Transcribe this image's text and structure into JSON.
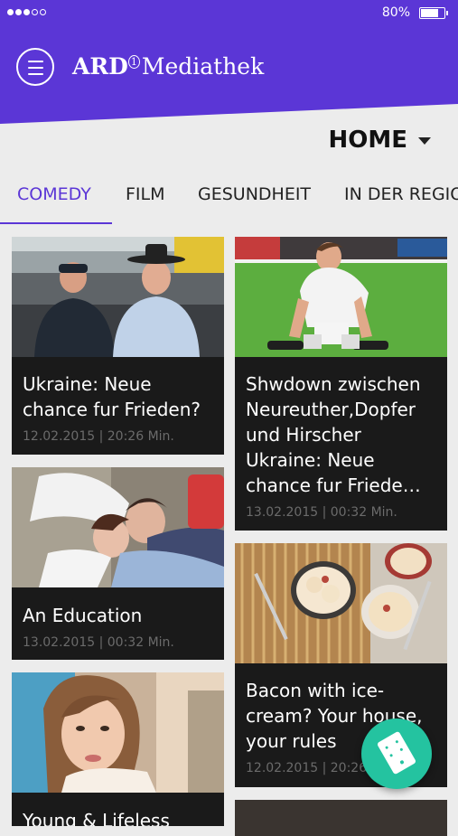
{
  "status_bar": {
    "battery": "80%",
    "battery_level": 0.8
  },
  "app": {
    "logo_bold": "ARD",
    "logo_mark": "1",
    "logo_rest": "Mediathek"
  },
  "nav": {
    "section": "HOME"
  },
  "tabs": [
    {
      "label": "COMEDY",
      "active": true
    },
    {
      "label": "FILM",
      "active": false
    },
    {
      "label": "GESUNDHEIT",
      "active": false
    },
    {
      "label": "IN DER REGIO",
      "active": false
    }
  ],
  "cards_left": [
    {
      "title": "Ukraine: Neue\nchance fur Frieden?",
      "meta": "12.02.2015 | 20:26 Min."
    },
    {
      "title": "An Education",
      "meta": "13.02.2015 | 00:32 Min."
    },
    {
      "title": "Young & Lifeless",
      "meta": ""
    }
  ],
  "cards_right": [
    {
      "title": "Shwdown zwischen\nNeureuther,Dopfer\nund Hirscher\nUkraine: Neue\nchance fur Friede…",
      "meta": "13.02.2015 | 00:32 Min."
    },
    {
      "title": "Bacon with ice-\ncream? Your house,\nyour rules",
      "meta": "12.02.2015 | 20:26 Min."
    }
  ],
  "colors": {
    "brand": "#5b36d6",
    "fab": "#24c3a0",
    "card": "#1a1a1a"
  },
  "icons": {
    "menu": "hamburger-icon",
    "dropdown": "caret-down-icon",
    "fab": "remote-control-icon"
  }
}
